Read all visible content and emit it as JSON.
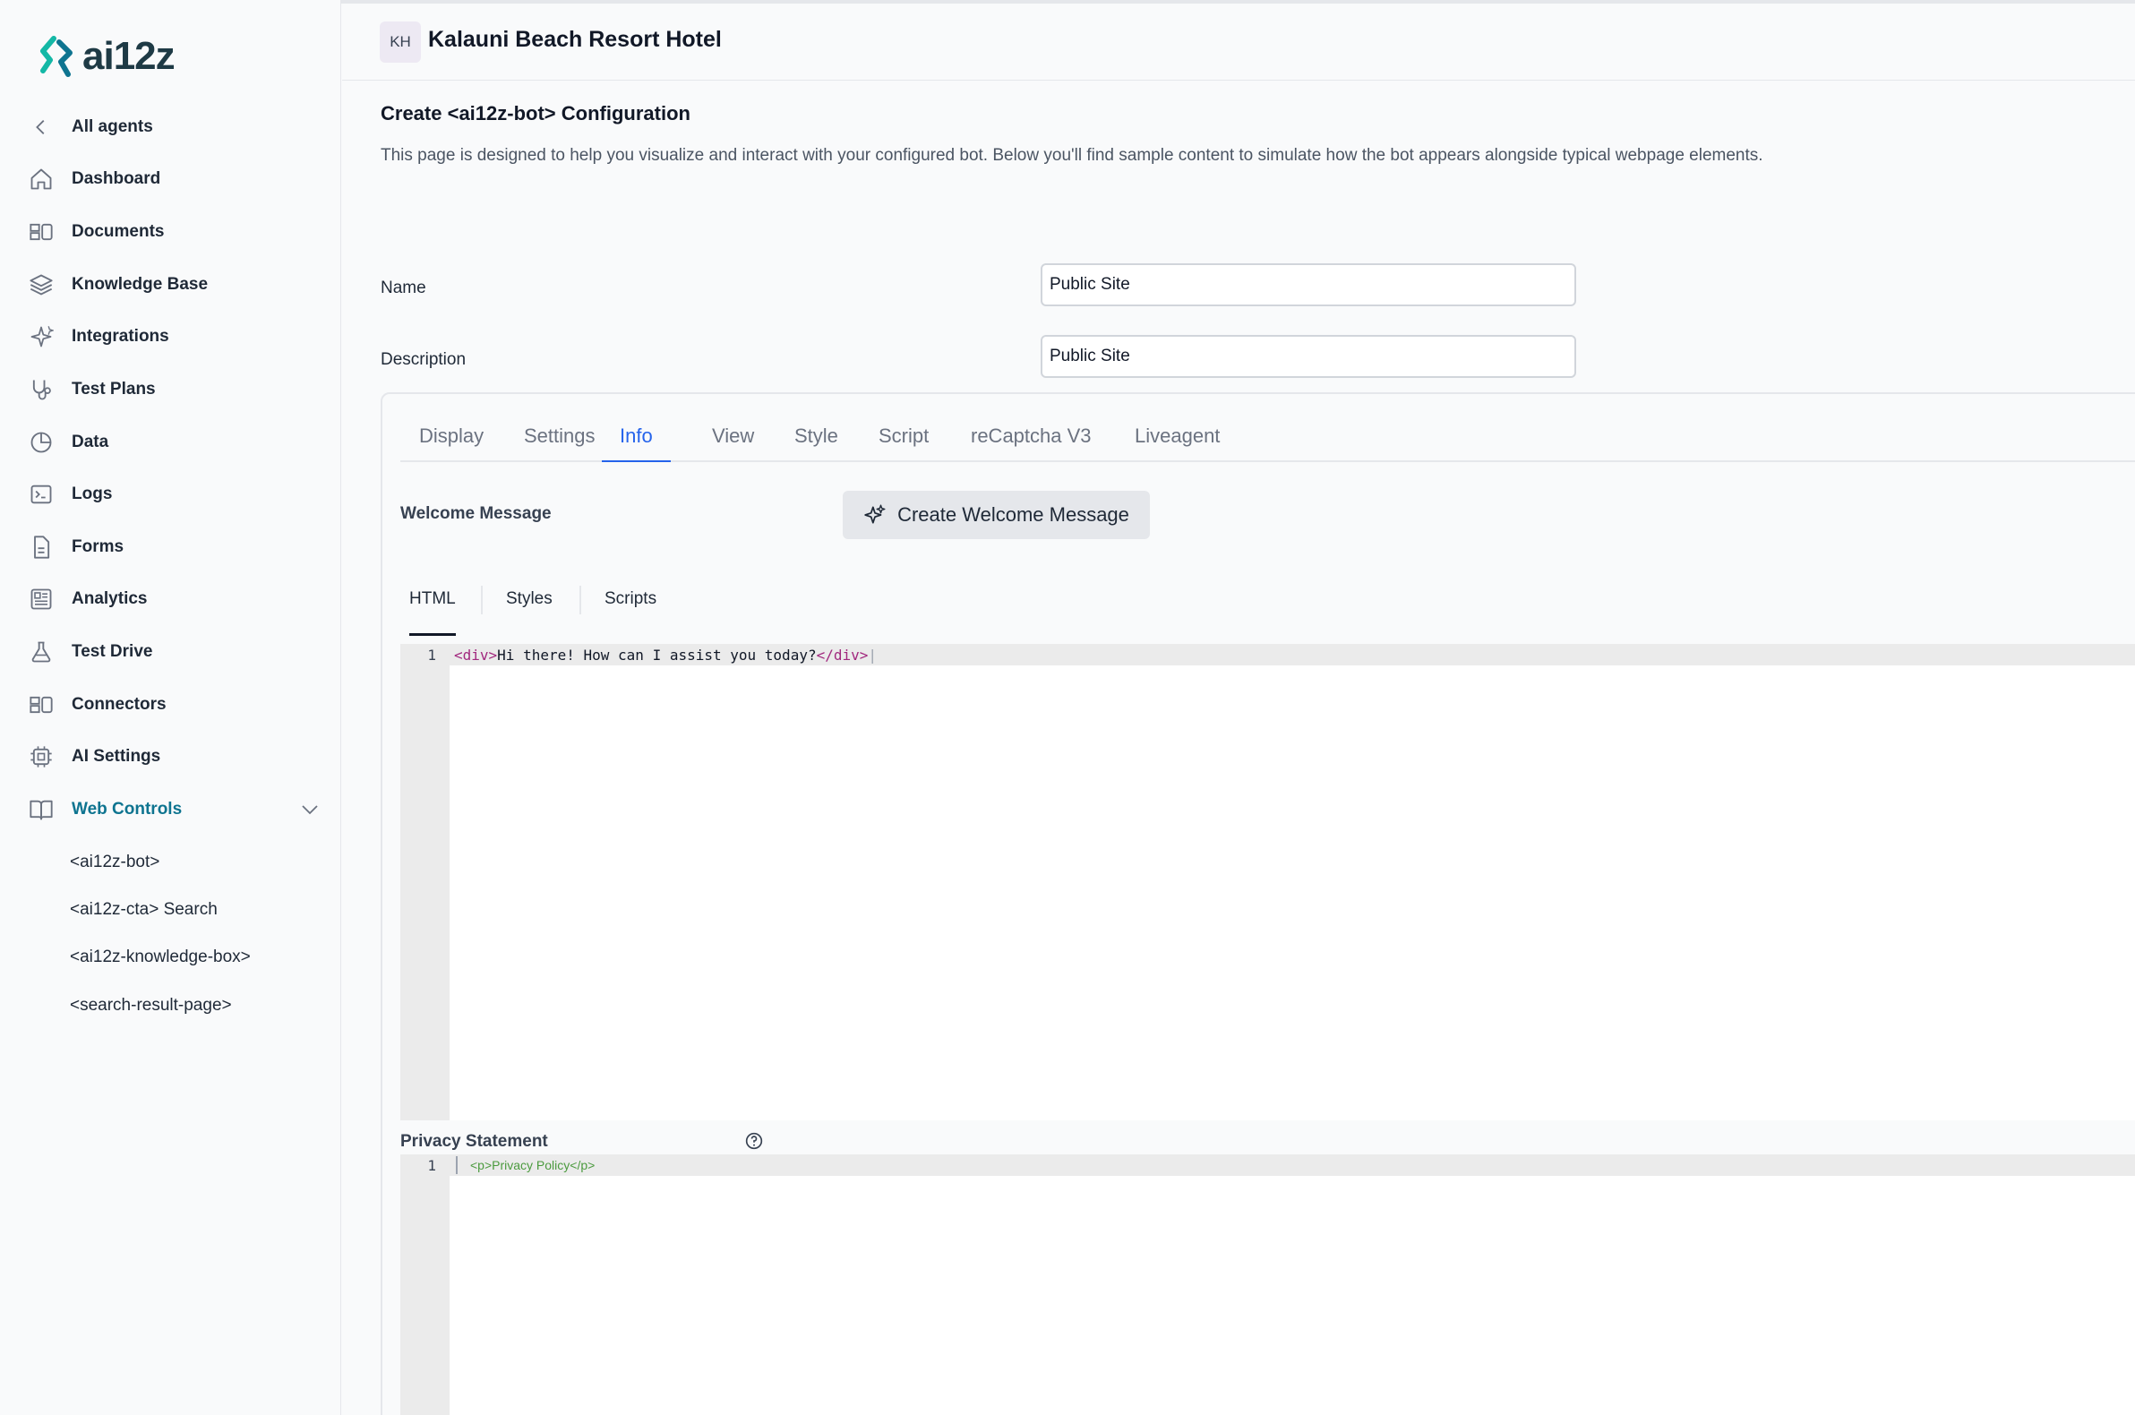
{
  "app": {
    "logo_text": "ai12z",
    "accent_color": "#0e7490"
  },
  "sidebar": {
    "back": {
      "label": "All agents",
      "icon": "chevron-left-icon"
    },
    "items": [
      {
        "label": "Dashboard",
        "icon": "home-icon"
      },
      {
        "label": "Documents",
        "icon": "documents-icon"
      },
      {
        "label": "Knowledge Base",
        "icon": "layers-icon"
      },
      {
        "label": "Integrations",
        "icon": "sparkles-icon"
      },
      {
        "label": "Test Plans",
        "icon": "stethoscope-icon"
      },
      {
        "label": "Data",
        "icon": "pie-chart-icon"
      },
      {
        "label": "Logs",
        "icon": "terminal-icon"
      },
      {
        "label": "Forms",
        "icon": "file-icon"
      },
      {
        "label": "Analytics",
        "icon": "newspaper-icon"
      },
      {
        "label": "Test Drive",
        "icon": "flask-icon"
      },
      {
        "label": "Connectors",
        "icon": "connectors-icon"
      },
      {
        "label": "AI Settings",
        "icon": "chip-icon"
      },
      {
        "label": "Web Controls",
        "icon": "book-icon",
        "active": true
      }
    ],
    "sub_items": [
      {
        "label": "<ai12z-bot>"
      },
      {
        "label": "<ai12z-cta> Search"
      },
      {
        "label": "<ai12z-knowledge-box>"
      },
      {
        "label": "<search-result-page>"
      }
    ]
  },
  "header": {
    "initials": "KH",
    "org_name": "Kalauni Beach Resort Hotel"
  },
  "main": {
    "title": "Create <ai12z-bot> Configuration",
    "description": "This page is designed to help you visualize and interact with your configured bot. Below you'll find sample content to simulate how the bot appears alongside typical webpage elements.",
    "name_label": "Name",
    "name_value": "Public Site",
    "description_label": "Description",
    "description_value": "Public Site",
    "tabs": [
      {
        "label": "Display"
      },
      {
        "label": "Settings"
      },
      {
        "label": "Info",
        "active": true
      },
      {
        "label": "View"
      },
      {
        "label": "Style"
      },
      {
        "label": "Script"
      },
      {
        "label": "reCaptcha V3"
      },
      {
        "label": "Liveagent"
      }
    ],
    "welcome_label": "Welcome Message",
    "welcome_button": "Create Welcome Message",
    "subtabs": [
      {
        "label": "HTML",
        "active": true
      },
      {
        "label": "Styles"
      },
      {
        "label": "Scripts"
      }
    ],
    "html_editor": {
      "line_number": "1",
      "open_tag": "<div>",
      "text": "Hi there! How can I assist you today?",
      "close_tag": "</div>"
    },
    "privacy_label": "Privacy Statement",
    "privacy_editor": {
      "line_number": "1",
      "placeholder": "<p>Privacy Policy</p>"
    }
  }
}
